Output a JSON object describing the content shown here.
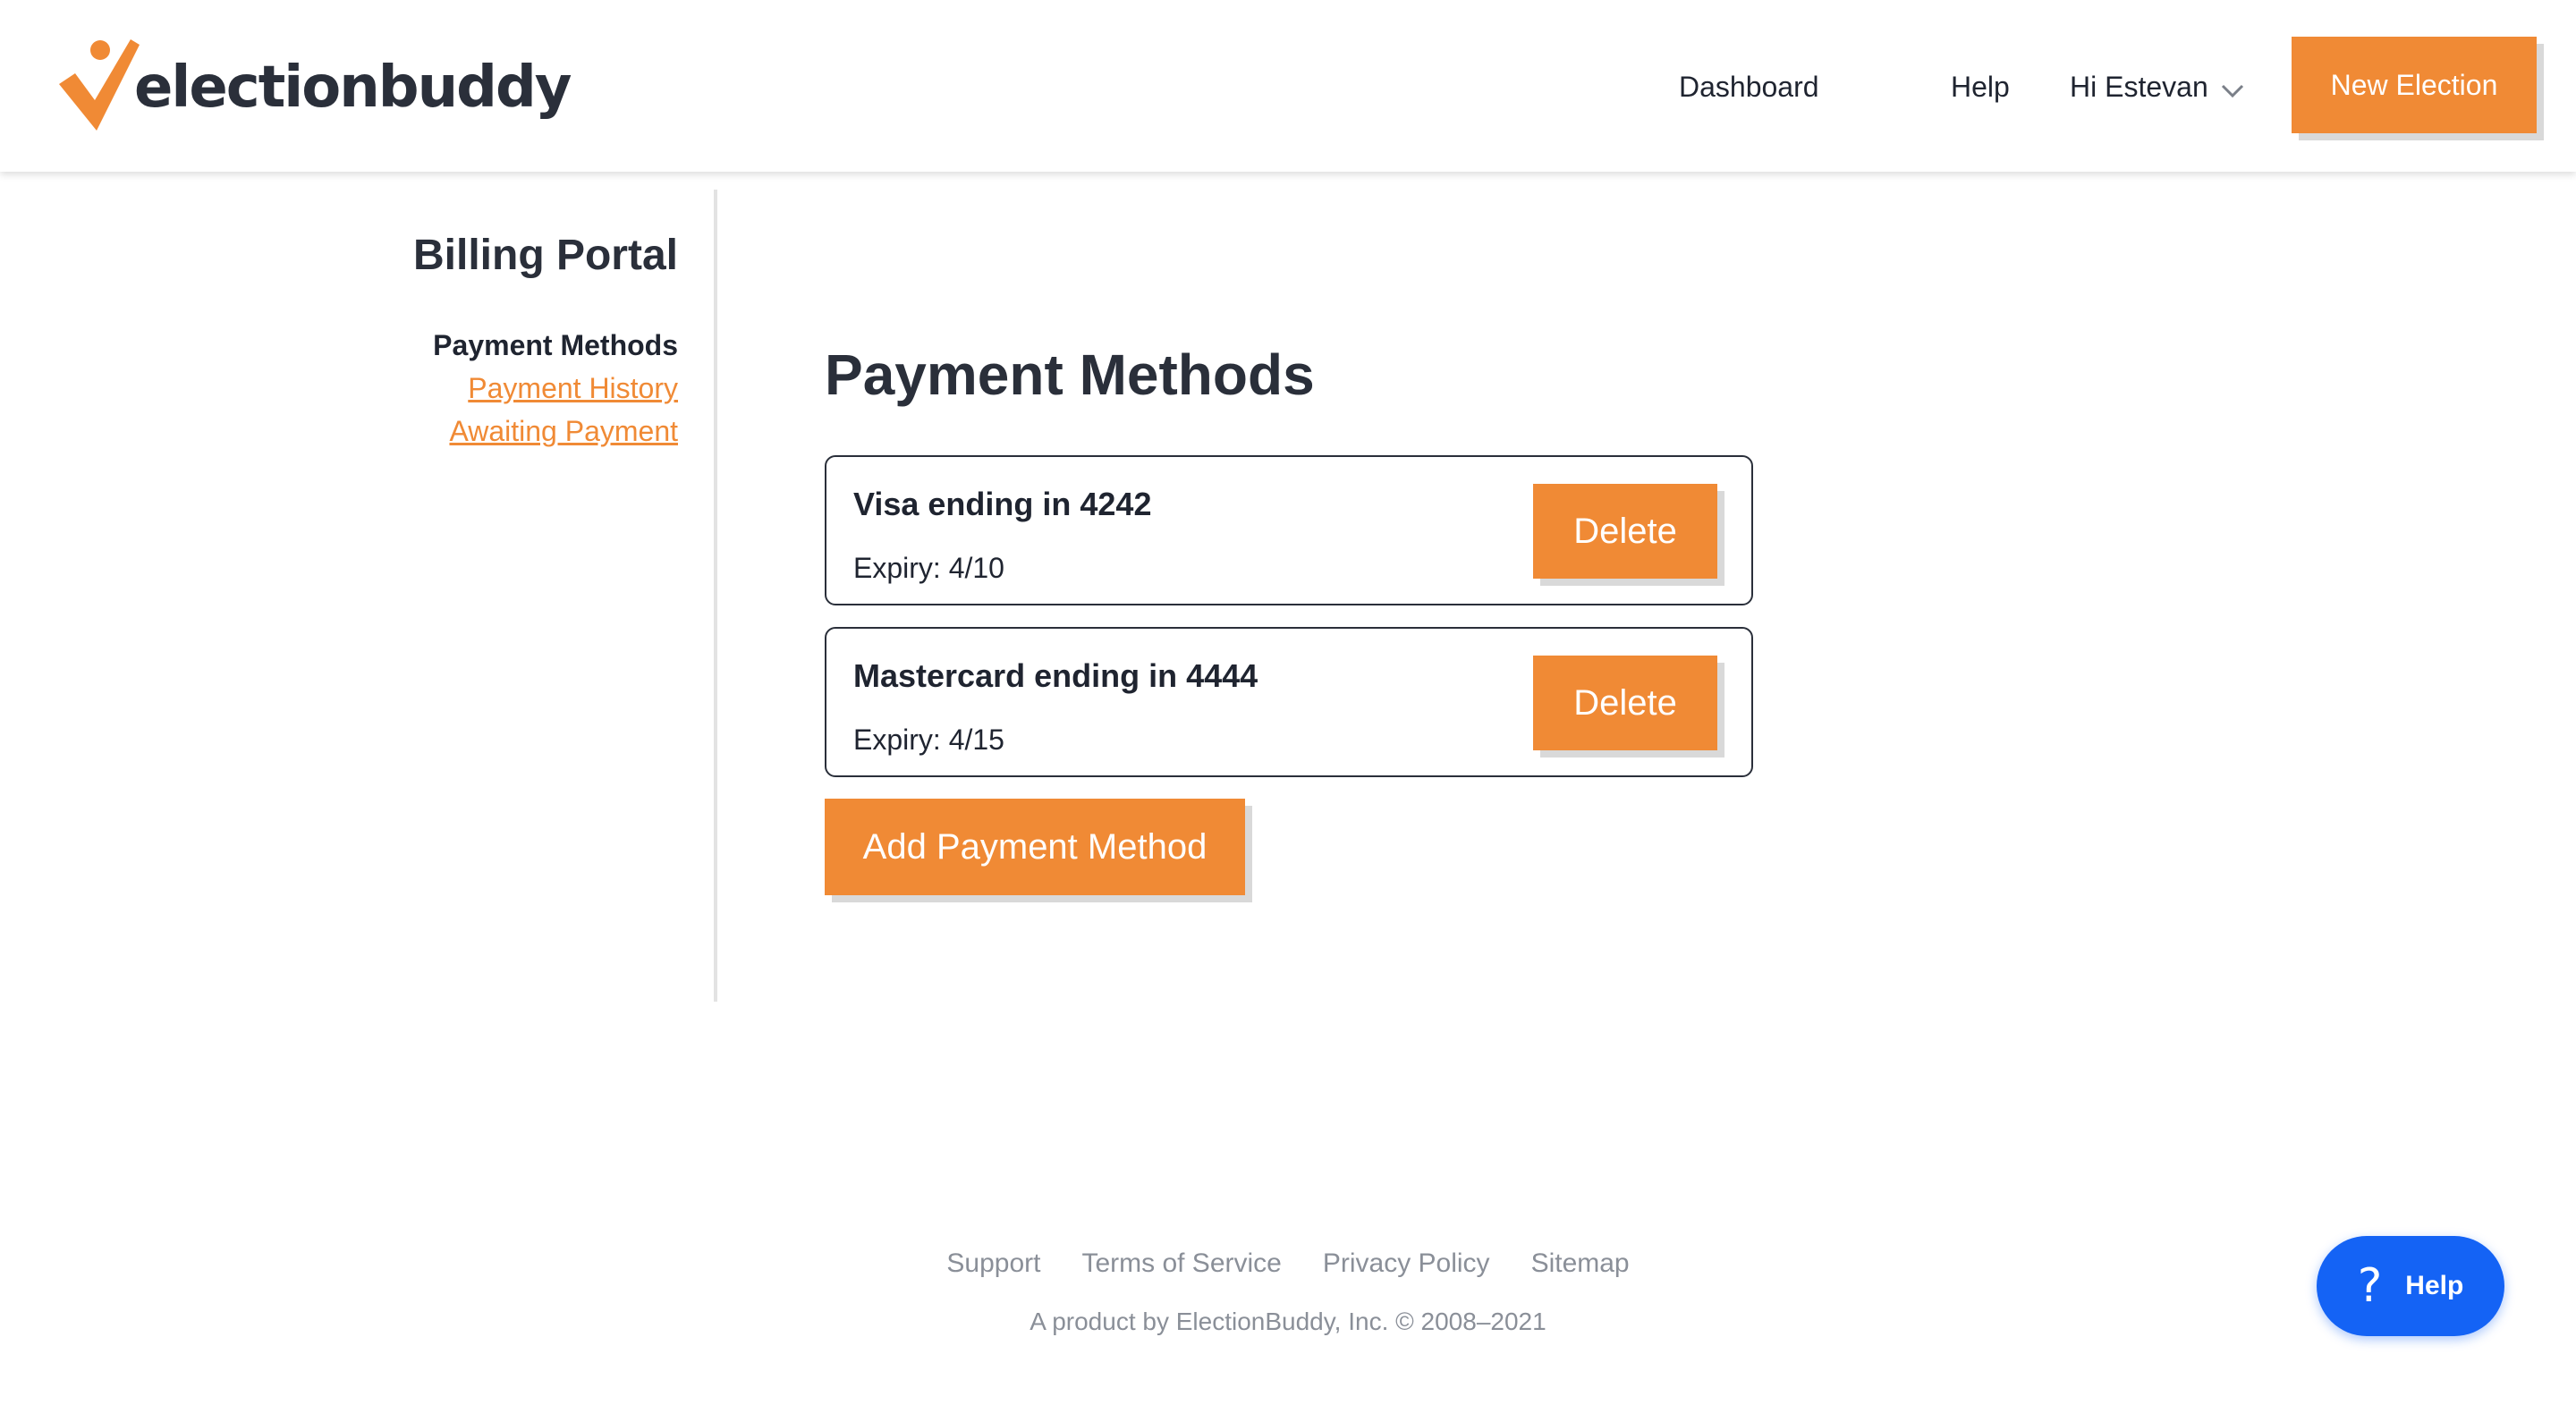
{
  "header": {
    "logo_text": "electionbuddy",
    "nav": {
      "dashboard": "Dashboard",
      "help": "Help",
      "user_greeting": "Hi Estevan"
    },
    "new_election_label": "New Election"
  },
  "sidebar": {
    "title": "Billing Portal",
    "items": [
      {
        "label": "Payment Methods",
        "active": true
      },
      {
        "label": "Payment History",
        "active": false
      },
      {
        "label": "Awaiting Payment",
        "active": false
      }
    ]
  },
  "main": {
    "title": "Payment Methods",
    "payment_methods": [
      {
        "title": "Visa ending in 4242",
        "expiry": "Expiry: 4/10",
        "delete_label": "Delete"
      },
      {
        "title": "Mastercard ending in 4444",
        "expiry": "Expiry: 4/15",
        "delete_label": "Delete"
      }
    ],
    "add_button_label": "Add Payment Method"
  },
  "footer": {
    "links": [
      "Support",
      "Terms of Service",
      "Privacy Policy",
      "Sitemap"
    ],
    "copyright": "A product by ElectionBuddy, Inc. © 2008–2021"
  },
  "help_widget": {
    "icon": "question-mark-icon",
    "label": "Help"
  },
  "colors": {
    "accent": "#f08a35",
    "help_widget": "#1463f5",
    "text": "#1f2430"
  }
}
